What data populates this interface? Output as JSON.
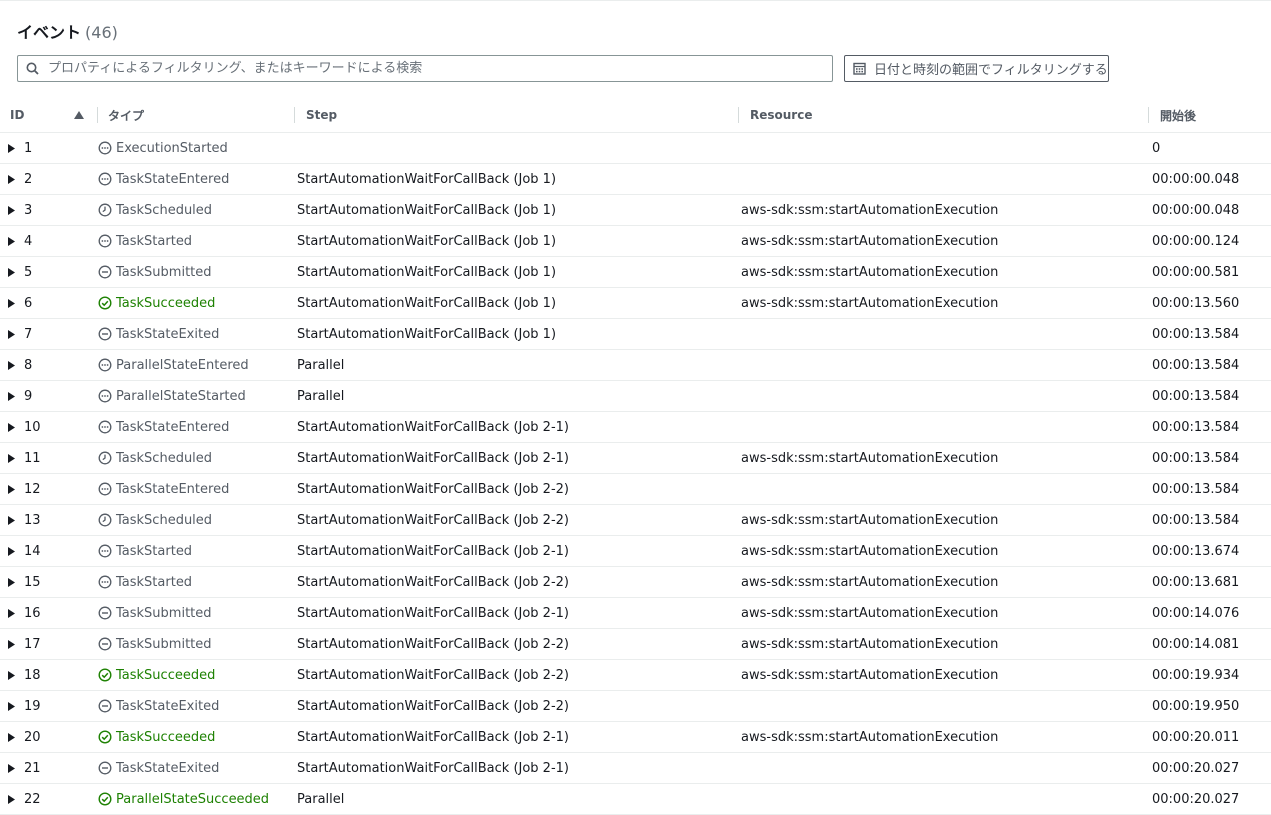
{
  "header": {
    "title": "イベント",
    "count": "(46)"
  },
  "search": {
    "placeholder": "プロパティによるフィルタリング、またはキーワードによる検索"
  },
  "date_filter": {
    "label": "日付と時刻の範囲でフィルタリングする"
  },
  "columns": {
    "id": "ID",
    "type": "タイプ",
    "step": "Step",
    "resource": "Resource",
    "elapsed": "開始後"
  },
  "colors": {
    "success": "#1d8102",
    "neutral": "#545b64"
  },
  "rows": [
    {
      "id": "1",
      "type": "ExecutionStarted",
      "icon": "dots-icon",
      "step": "",
      "resource": "",
      "elapsed": "0"
    },
    {
      "id": "2",
      "type": "TaskStateEntered",
      "icon": "dots-icon",
      "step": "StartAutomationWaitForCallBack (Job 1)",
      "resource": "",
      "elapsed": "00:00:00.048"
    },
    {
      "id": "3",
      "type": "TaskScheduled",
      "icon": "clock-icon",
      "step": "StartAutomationWaitForCallBack (Job 1)",
      "resource": "aws-sdk:ssm:startAutomationExecution",
      "elapsed": "00:00:00.048"
    },
    {
      "id": "4",
      "type": "TaskStarted",
      "icon": "dots-icon",
      "step": "StartAutomationWaitForCallBack (Job 1)",
      "resource": "aws-sdk:ssm:startAutomationExecution",
      "elapsed": "00:00:00.124"
    },
    {
      "id": "5",
      "type": "TaskSubmitted",
      "icon": "minus-icon",
      "step": "StartAutomationWaitForCallBack (Job 1)",
      "resource": "aws-sdk:ssm:startAutomationExecution",
      "elapsed": "00:00:00.581"
    },
    {
      "id": "6",
      "type": "TaskSucceeded",
      "icon": "check-icon",
      "step": "StartAutomationWaitForCallBack (Job 1)",
      "resource": "aws-sdk:ssm:startAutomationExecution",
      "elapsed": "00:00:13.560"
    },
    {
      "id": "7",
      "type": "TaskStateExited",
      "icon": "minus-icon",
      "step": "StartAutomationWaitForCallBack (Job 1)",
      "resource": "",
      "elapsed": "00:00:13.584"
    },
    {
      "id": "8",
      "type": "ParallelStateEntered",
      "icon": "dots-icon",
      "step": "Parallel",
      "resource": "",
      "elapsed": "00:00:13.584"
    },
    {
      "id": "9",
      "type": "ParallelStateStarted",
      "icon": "dots-icon",
      "step": "Parallel",
      "resource": "",
      "elapsed": "00:00:13.584"
    },
    {
      "id": "10",
      "type": "TaskStateEntered",
      "icon": "dots-icon",
      "step": "StartAutomationWaitForCallBack (Job 2-1)",
      "resource": "",
      "elapsed": "00:00:13.584"
    },
    {
      "id": "11",
      "type": "TaskScheduled",
      "icon": "clock-icon",
      "step": "StartAutomationWaitForCallBack (Job 2-1)",
      "resource": "aws-sdk:ssm:startAutomationExecution",
      "elapsed": "00:00:13.584"
    },
    {
      "id": "12",
      "type": "TaskStateEntered",
      "icon": "dots-icon",
      "step": "StartAutomationWaitForCallBack (Job 2-2)",
      "resource": "",
      "elapsed": "00:00:13.584"
    },
    {
      "id": "13",
      "type": "TaskScheduled",
      "icon": "clock-icon",
      "step": "StartAutomationWaitForCallBack (Job 2-2)",
      "resource": "aws-sdk:ssm:startAutomationExecution",
      "elapsed": "00:00:13.584"
    },
    {
      "id": "14",
      "type": "TaskStarted",
      "icon": "dots-icon",
      "step": "StartAutomationWaitForCallBack (Job 2-1)",
      "resource": "aws-sdk:ssm:startAutomationExecution",
      "elapsed": "00:00:13.674"
    },
    {
      "id": "15",
      "type": "TaskStarted",
      "icon": "dots-icon",
      "step": "StartAutomationWaitForCallBack (Job 2-2)",
      "resource": "aws-sdk:ssm:startAutomationExecution",
      "elapsed": "00:00:13.681"
    },
    {
      "id": "16",
      "type": "TaskSubmitted",
      "icon": "minus-icon",
      "step": "StartAutomationWaitForCallBack (Job 2-1)",
      "resource": "aws-sdk:ssm:startAutomationExecution",
      "elapsed": "00:00:14.076"
    },
    {
      "id": "17",
      "type": "TaskSubmitted",
      "icon": "minus-icon",
      "step": "StartAutomationWaitForCallBack (Job 2-2)",
      "resource": "aws-sdk:ssm:startAutomationExecution",
      "elapsed": "00:00:14.081"
    },
    {
      "id": "18",
      "type": "TaskSucceeded",
      "icon": "check-icon",
      "step": "StartAutomationWaitForCallBack (Job 2-2)",
      "resource": "aws-sdk:ssm:startAutomationExecution",
      "elapsed": "00:00:19.934"
    },
    {
      "id": "19",
      "type": "TaskStateExited",
      "icon": "minus-icon",
      "step": "StartAutomationWaitForCallBack (Job 2-2)",
      "resource": "",
      "elapsed": "00:00:19.950"
    },
    {
      "id": "20",
      "type": "TaskSucceeded",
      "icon": "check-icon",
      "step": "StartAutomationWaitForCallBack (Job 2-1)",
      "resource": "aws-sdk:ssm:startAutomationExecution",
      "elapsed": "00:00:20.011"
    },
    {
      "id": "21",
      "type": "TaskStateExited",
      "icon": "minus-icon",
      "step": "StartAutomationWaitForCallBack (Job 2-1)",
      "resource": "",
      "elapsed": "00:00:20.027"
    },
    {
      "id": "22",
      "type": "ParallelStateSucceeded",
      "icon": "check-icon",
      "step": "Parallel",
      "resource": "",
      "elapsed": "00:00:20.027"
    }
  ]
}
